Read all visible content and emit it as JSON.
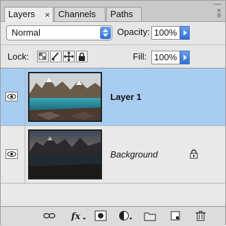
{
  "tabs": [
    {
      "label": "Layers",
      "active": true
    },
    {
      "label": "Channels",
      "active": false
    },
    {
      "label": "Paths",
      "active": false
    }
  ],
  "tab_close_glyph": "×",
  "window": {
    "collapse_glyph": "—",
    "close_glyph": "×",
    "menu_glyph": "≡"
  },
  "blend_mode": {
    "value": "Normal"
  },
  "opacity": {
    "label": "Opacity:",
    "value": "100%"
  },
  "lock": {
    "label": "Lock:"
  },
  "fill": {
    "label": "Fill:",
    "value": "100%"
  },
  "layers": [
    {
      "name": "Layer 1",
      "selected": true,
      "visible": true,
      "locked": false
    },
    {
      "name": "Background",
      "selected": false,
      "visible": true,
      "locked": true
    }
  ],
  "bottom_icons": [
    "link-layers-icon",
    "layer-style-fx-icon",
    "add-mask-icon",
    "adjustment-layer-icon",
    "new-group-icon",
    "new-layer-icon",
    "trash-icon"
  ],
  "colors": {
    "selection": "#a8cdf3",
    "accent_blue": "#2f6fd8"
  }
}
